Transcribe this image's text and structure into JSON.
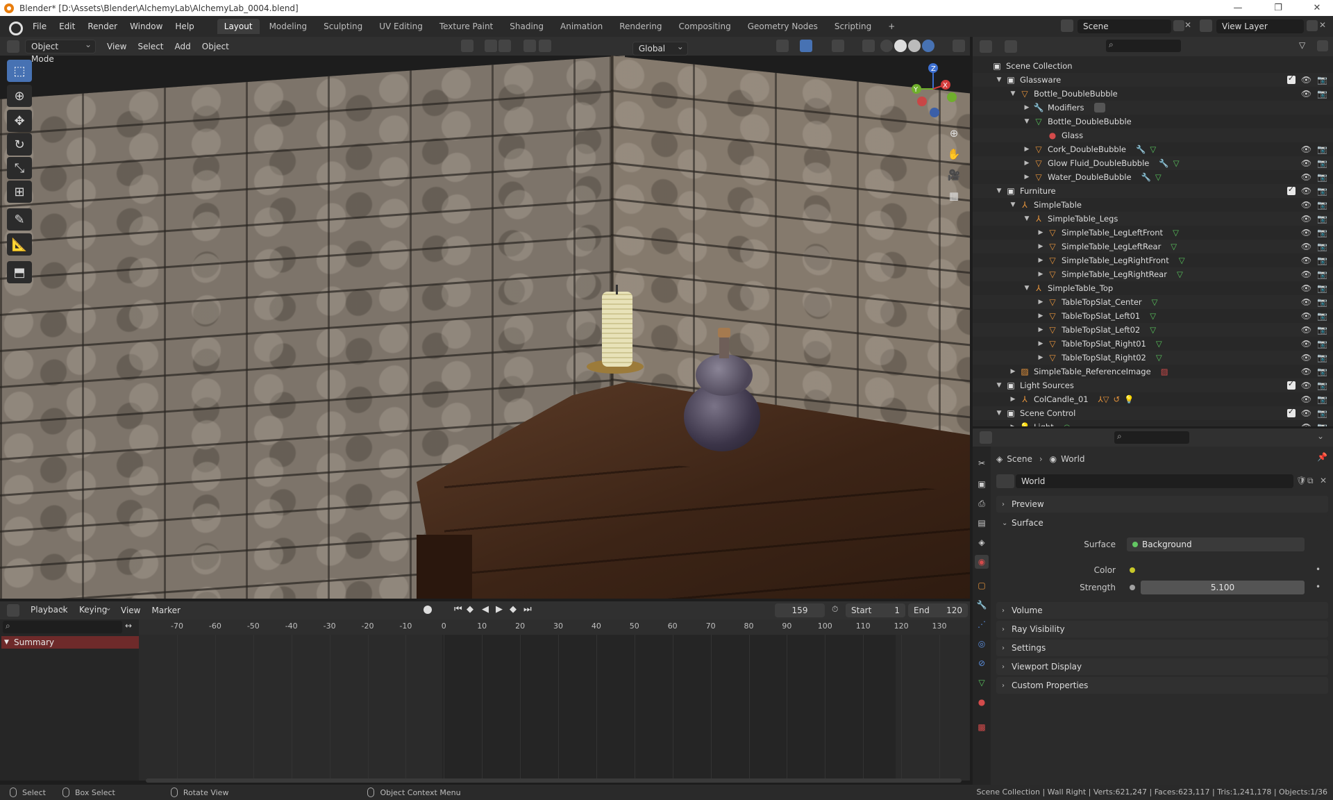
{
  "window": {
    "title": "Blender* [D:\\Assets\\Blender\\AlchemyLab\\AlchemyLab_0004.blend]",
    "controls": [
      "—",
      "❐",
      "✕"
    ]
  },
  "menu": {
    "items": [
      "File",
      "Edit",
      "Render",
      "Window",
      "Help"
    ],
    "workspaces": [
      "Layout",
      "Modeling",
      "Sculpting",
      "UV Editing",
      "Texture Paint",
      "Shading",
      "Animation",
      "Rendering",
      "Compositing",
      "Geometry Nodes",
      "Scripting"
    ],
    "add_tab": "+",
    "scene": "Scene",
    "view_layer": "View Layer"
  },
  "viewport_header": {
    "mode": "Object Mode",
    "menus": [
      "View",
      "Select",
      "Add",
      "Object"
    ],
    "transform_orientation": "Global"
  },
  "gizmo": {
    "x": "X",
    "y": "Y",
    "z": "Z"
  },
  "timeline": {
    "menus": [
      "Playback",
      "Keying",
      "View",
      "Marker"
    ],
    "current_frame": "159",
    "start_label": "Start",
    "start": "1",
    "end_label": "End",
    "end": "120",
    "ticks": [
      "-70",
      "-60",
      "-50",
      "-40",
      "-30",
      "-20",
      "-10",
      "0",
      "10",
      "20",
      "30",
      "40",
      "50",
      "60",
      "70",
      "80",
      "90",
      "100",
      "110",
      "120",
      "130"
    ],
    "summary": "Summary"
  },
  "statusbar": {
    "select": "Select",
    "box_select": "Box Select",
    "rotate_view": "Rotate View",
    "context_menu": "Object Context Menu",
    "stats": "Scene Collection | Wall Right | Verts:621,247 | Faces:623,117 | Tris:1,241,178 | Objects:1/36"
  },
  "outliner": {
    "rows": [
      {
        "label": "Scene Collection",
        "depth": 0,
        "icon": "collection",
        "twisty": "",
        "check": false,
        "eye": false,
        "extra": ""
      },
      {
        "label": "Glassware",
        "depth": 1,
        "icon": "collection",
        "twisty": "▼",
        "check": true,
        "eye": true,
        "extra": ""
      },
      {
        "label": "Bottle_DoubleBubble",
        "depth": 2,
        "icon": "mesh",
        "twisty": "▼",
        "check": false,
        "eye": true,
        "extra": ""
      },
      {
        "label": "Modifiers",
        "depth": 3,
        "icon": "wrench",
        "twisty": "▶",
        "check": false,
        "eye": false,
        "extra": "modifier"
      },
      {
        "label": "Bottle_DoubleBubble",
        "depth": 3,
        "icon": "meshdata",
        "twisty": "▼",
        "check": false,
        "eye": false,
        "extra": ""
      },
      {
        "label": "Glass",
        "depth": 4,
        "icon": "material",
        "twisty": "",
        "check": false,
        "eye": false,
        "extra": ""
      },
      {
        "label": "Cork_DoubleBubble",
        "depth": 3,
        "icon": "mesh",
        "twisty": "▶",
        "check": false,
        "eye": true,
        "extra": "wrench-mesh"
      },
      {
        "label": "Glow Fluid_DoubleBubble",
        "depth": 3,
        "icon": "mesh",
        "twisty": "▶",
        "check": false,
        "eye": true,
        "extra": "wrench-mesh"
      },
      {
        "label": "Water_DoubleBubble",
        "depth": 3,
        "icon": "mesh",
        "twisty": "▶",
        "check": false,
        "eye": true,
        "extra": "wrench-mesh"
      },
      {
        "label": "Furniture",
        "depth": 1,
        "icon": "collection",
        "twisty": "▼",
        "check": true,
        "eye": true,
        "extra": ""
      },
      {
        "label": "SimpleTable",
        "depth": 2,
        "icon": "empty",
        "twisty": "▼",
        "check": false,
        "eye": true,
        "extra": ""
      },
      {
        "label": "SimpleTable_Legs",
        "depth": 3,
        "icon": "empty",
        "twisty": "▼",
        "check": false,
        "eye": true,
        "extra": ""
      },
      {
        "label": "SimpleTable_LegLeftFront",
        "depth": 4,
        "icon": "mesh",
        "twisty": "▶",
        "check": false,
        "eye": true,
        "extra": "mesh"
      },
      {
        "label": "SimpleTable_LegLeftRear",
        "depth": 4,
        "icon": "mesh",
        "twisty": "▶",
        "check": false,
        "eye": true,
        "extra": "mesh"
      },
      {
        "label": "SimpleTable_LegRightFront",
        "depth": 4,
        "icon": "mesh",
        "twisty": "▶",
        "check": false,
        "eye": true,
        "extra": "mesh"
      },
      {
        "label": "SimpleTable_LegRightRear",
        "depth": 4,
        "icon": "mesh",
        "twisty": "▶",
        "check": false,
        "eye": true,
        "extra": "mesh"
      },
      {
        "label": "SimpleTable_Top",
        "depth": 3,
        "icon": "empty",
        "twisty": "▼",
        "check": false,
        "eye": true,
        "extra": ""
      },
      {
        "label": "TableTopSlat_Center",
        "depth": 4,
        "icon": "mesh",
        "twisty": "▶",
        "check": false,
        "eye": true,
        "extra": "mesh"
      },
      {
        "label": "TableTopSlat_Left01",
        "depth": 4,
        "icon": "mesh",
        "twisty": "▶",
        "check": false,
        "eye": true,
        "extra": "mesh"
      },
      {
        "label": "TableTopSlat_Left02",
        "depth": 4,
        "icon": "mesh",
        "twisty": "▶",
        "check": false,
        "eye": true,
        "extra": "mesh"
      },
      {
        "label": "TableTopSlat_Right01",
        "depth": 4,
        "icon": "mesh",
        "twisty": "▶",
        "check": false,
        "eye": true,
        "extra": "mesh"
      },
      {
        "label": "TableTopSlat_Right02",
        "depth": 4,
        "icon": "mesh",
        "twisty": "▶",
        "check": false,
        "eye": true,
        "extra": "mesh"
      },
      {
        "label": "SimpleTable_ReferenceImage",
        "depth": 2,
        "icon": "image",
        "twisty": "▶",
        "check": false,
        "eye": true,
        "extra": "image"
      },
      {
        "label": "Light Sources",
        "depth": 1,
        "icon": "collection",
        "twisty": "▼",
        "check": true,
        "eye": true,
        "extra": ""
      },
      {
        "label": "ColCandle_01",
        "depth": 2,
        "icon": "empty",
        "twisty": "▶",
        "check": false,
        "eye": true,
        "extra": "candle"
      },
      {
        "label": "Scene Control",
        "depth": 1,
        "icon": "collection",
        "twisty": "▼",
        "check": true,
        "eye": true,
        "extra": ""
      },
      {
        "label": "Light",
        "depth": 2,
        "icon": "light",
        "twisty": "▶",
        "check": false,
        "eye": true,
        "extra": "lightdata"
      }
    ]
  },
  "properties": {
    "breadcrumb_scene": "Scene",
    "breadcrumb_world": "World",
    "world_name": "World",
    "panels": {
      "preview": "Preview",
      "surface": "Surface",
      "volume": "Volume",
      "ray_visibility": "Ray Visibility",
      "settings": "Settings",
      "viewport_display": "Viewport Display",
      "custom_properties": "Custom Properties"
    },
    "surface_label": "Surface",
    "surface_value": "Background",
    "color_label": "Color",
    "strength_label": "Strength",
    "strength_value": "5.100"
  },
  "colors": {
    "accent": "#4772b3",
    "mesh_icon": "#e8953c",
    "meshdata_icon": "#58c25c",
    "collection_icon": "#e0e0e0",
    "summary_bg": "#6e2a2a",
    "socket_yellow": "#c7c729",
    "socket_green": "#63c763",
    "socket_grey": "#a1a1a1"
  }
}
